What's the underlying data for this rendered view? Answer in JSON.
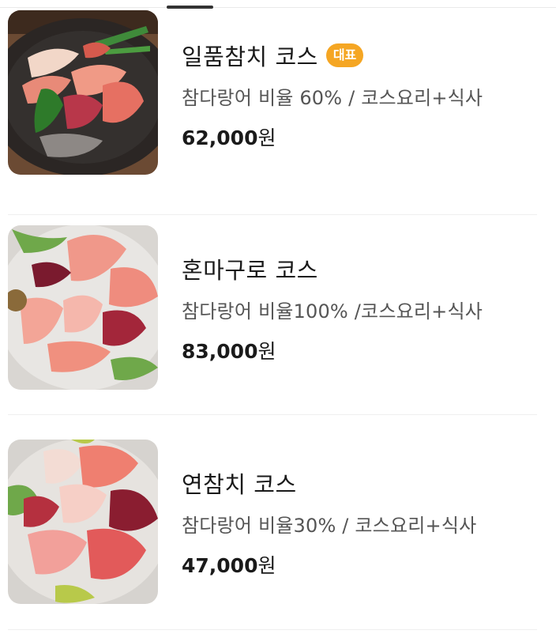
{
  "menu": {
    "items": [
      {
        "name": "일품참치 코스",
        "badge": "대표",
        "description": "참다랑어 비율 60% / 코스요리+식사",
        "price": "62,000",
        "currency": "원",
        "image_icon": "tuna-sashimi-platter-image"
      },
      {
        "name": "혼마구로 코스",
        "badge": "",
        "description": "참다랑어 비율100% /코스요리+식사",
        "price": "83,000",
        "currency": "원",
        "image_icon": "tuna-sashimi-platter-image"
      },
      {
        "name": "연참치 코스",
        "badge": "",
        "description": "참다랑어 비율30% / 코스요리+식사",
        "price": "47,000",
        "currency": "원",
        "image_icon": "tuna-sashimi-platter-image"
      }
    ]
  },
  "colors": {
    "badge": "#f5a623",
    "title": "#1a1a1a",
    "description": "#555555",
    "divider": "#efefef"
  }
}
